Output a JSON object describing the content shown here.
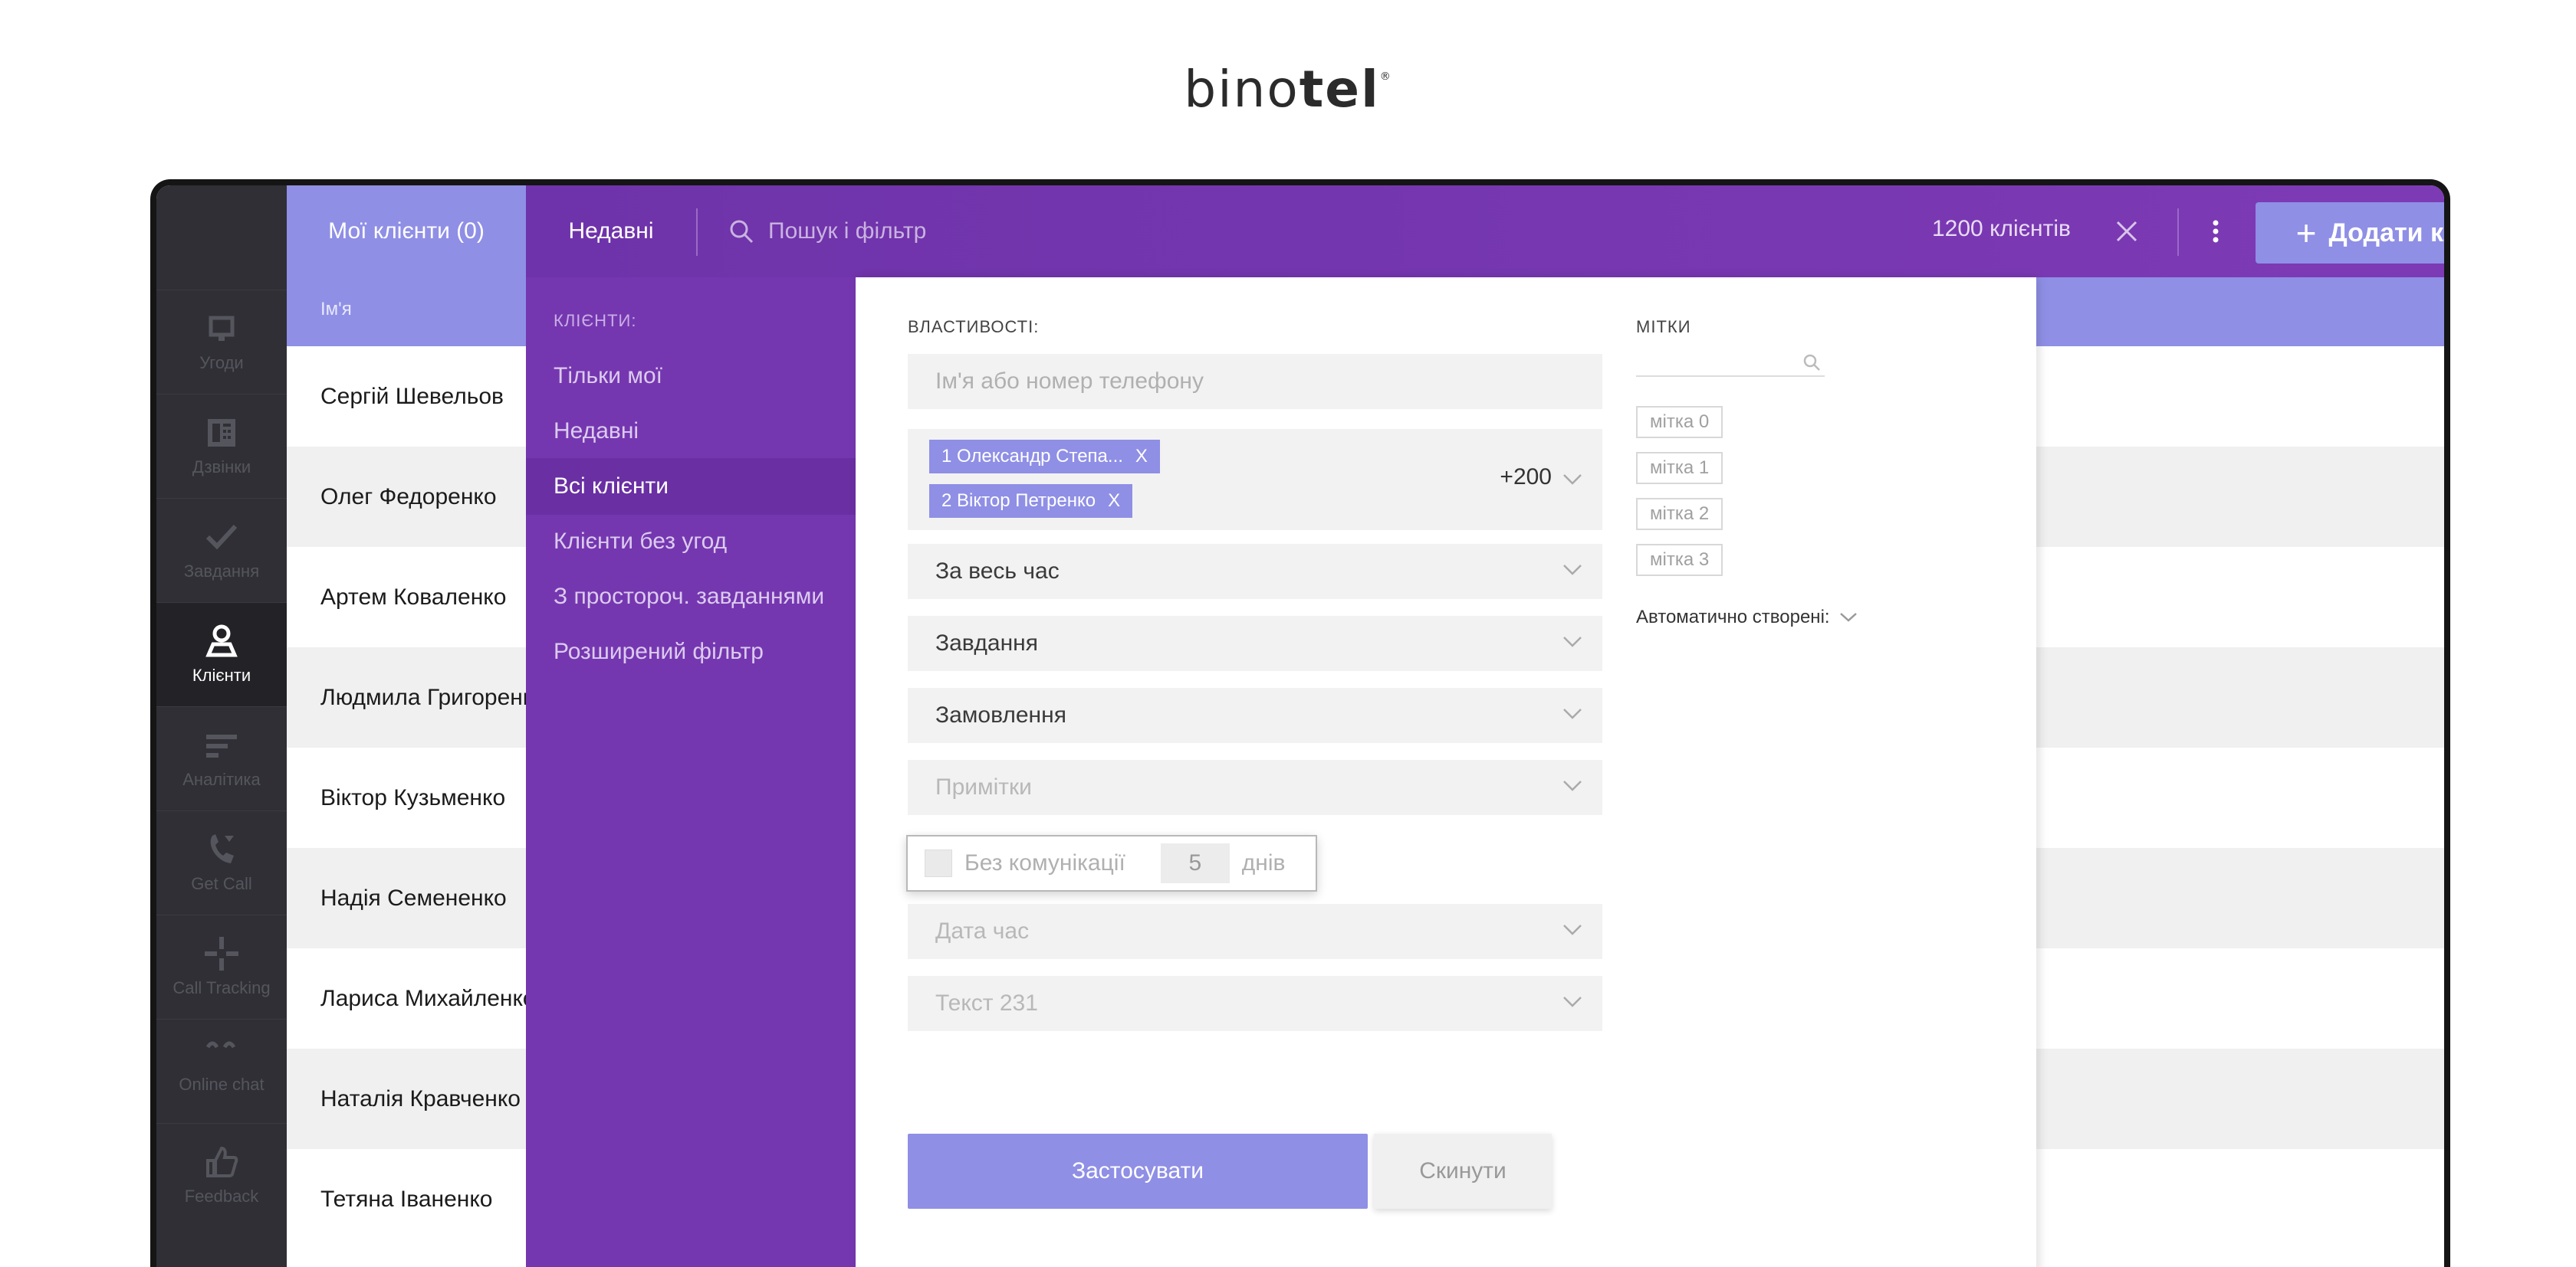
{
  "logo": {
    "light": "bino",
    "bold": "tel",
    "mark": "®"
  },
  "nav": [
    {
      "label": "Угоди",
      "icon": "deals-icon"
    },
    {
      "label": "Дзвінки",
      "icon": "phone-icon"
    },
    {
      "label": "Завдання",
      "icon": "checkmark-icon"
    },
    {
      "label": "Клієнти",
      "icon": "user-icon",
      "active": true
    },
    {
      "label": "Аналітика",
      "icon": "analytics-icon"
    },
    {
      "label": "Get Call",
      "icon": "get-call-icon"
    },
    {
      "label": "Call Tracking",
      "icon": "call-tracking-icon"
    },
    {
      "label": "Online chat",
      "icon": "chat-icon"
    },
    {
      "label": "Feedback",
      "icon": "thumbs-up-icon"
    }
  ],
  "topbar": {
    "tab_my": "Мої клієнти (0)",
    "tab_recent": "Недавні",
    "search_placeholder": "Пошук і фільтр",
    "count": "1200 клієнтів",
    "add_button": "Додати клієнта"
  },
  "list": {
    "column_name": "Ім'я",
    "rows": [
      "Сергій Шевельов",
      "Олег Федоренко",
      "Артем Коваленко",
      "Людмила Григоренко",
      "Віктор Кузьменко",
      "Надія Семененко",
      "Лариса Михайленко",
      "Наталія Кравченко",
      "Тетяна Іваненко"
    ]
  },
  "filter_menu": {
    "title": "КЛІЄНТИ:",
    "items": [
      "Тільки мої",
      "Недавні",
      "Всі клієнти",
      "Клієнти без угод",
      "З простороч. завданнями",
      "Розширений фільтр"
    ],
    "selected_index": 2
  },
  "filter_panel": {
    "properties_title": "ВЛАСТИВОСТІ:",
    "name_phone_placeholder": "Ім'я або номер телефону",
    "chips": [
      "1 Олександр Степа...",
      "2 Віктор Петренко"
    ],
    "chip_remove": "X",
    "more_count": "+200",
    "period": "За весь час",
    "tasks": "Завдання",
    "orders": "Замовлення",
    "notes": "Примітки",
    "no_communication": "Без комунікації",
    "no_communication_days": "5",
    "days_label": "днів",
    "date_time": "Дата час",
    "text_field": "Текст 231",
    "tags_title": "МІТКИ",
    "tags": [
      "мітка 0",
      "мітка 1",
      "мітка 2",
      "мітка 3"
    ],
    "auto_created": "Автоматично створені:",
    "apply": "Застосувати",
    "reset": "Скинути"
  }
}
